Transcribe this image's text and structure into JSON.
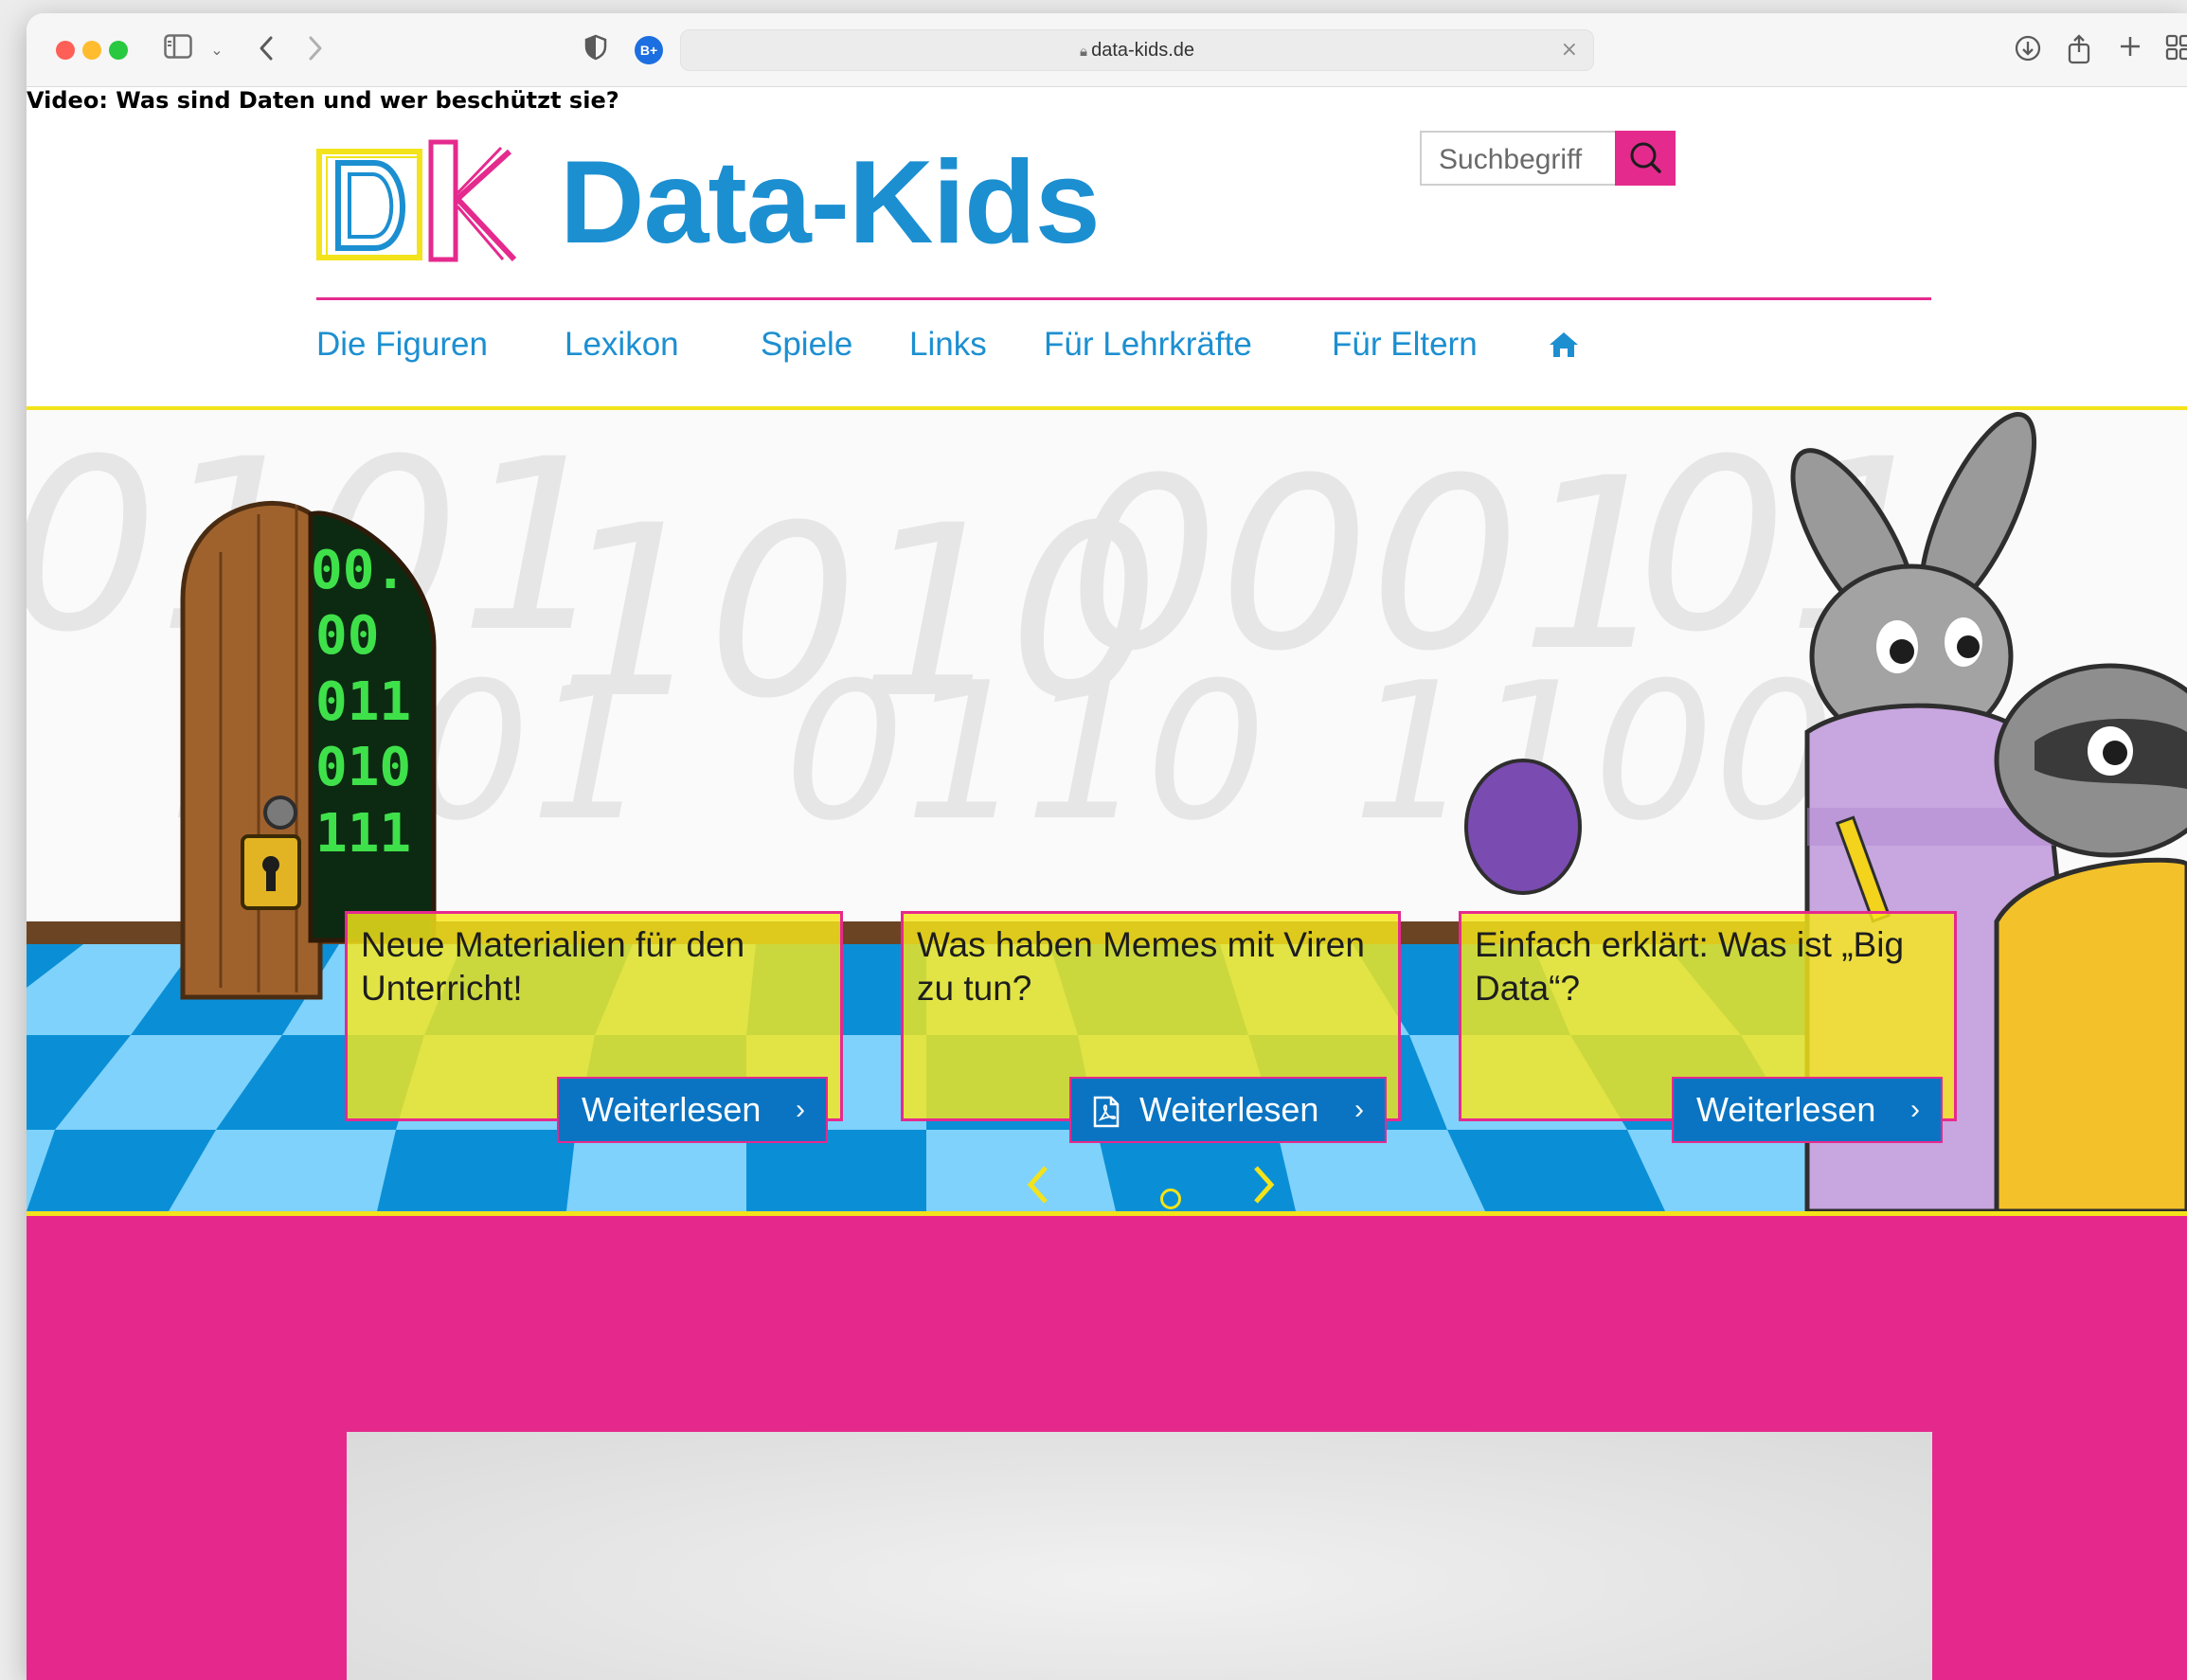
{
  "browser": {
    "url": "data-kids.de",
    "extension_badge": "B+"
  },
  "header": {
    "logo_mark": "DK",
    "logo_text": "Data-Kids",
    "search_placeholder": "Suchbegriff"
  },
  "nav": {
    "items": [
      {
        "label": "Die Figuren"
      },
      {
        "label": "Lexikon"
      },
      {
        "label": "Spiele"
      },
      {
        "label": "Links"
      },
      {
        "label": "Für Lehrkräfte"
      },
      {
        "label": "Für Eltern"
      }
    ],
    "home_icon": "home-icon"
  },
  "hero": {
    "door_digits": [
      "00.",
      "00",
      "011",
      "010",
      "111"
    ],
    "cards": [
      {
        "title": "Neue Materialien für den Unterricht!",
        "button": "Weiterlesen"
      },
      {
        "title": "Was haben Memes mit Viren zu tun?",
        "button": "Weiterlesen",
        "button_icon": "pdf-icon"
      },
      {
        "title": "Einfach erklärt: Was ist „Big Data“?",
        "button": "Weiterlesen"
      }
    ]
  },
  "video_section": {
    "title": "Video: Was sind Daten und wer beschützt sie?"
  },
  "colors": {
    "pink": "#e52a8e",
    "blue": "#1c8fd1",
    "yellow": "#f3e31b",
    "button_blue": "#0a74c2"
  }
}
